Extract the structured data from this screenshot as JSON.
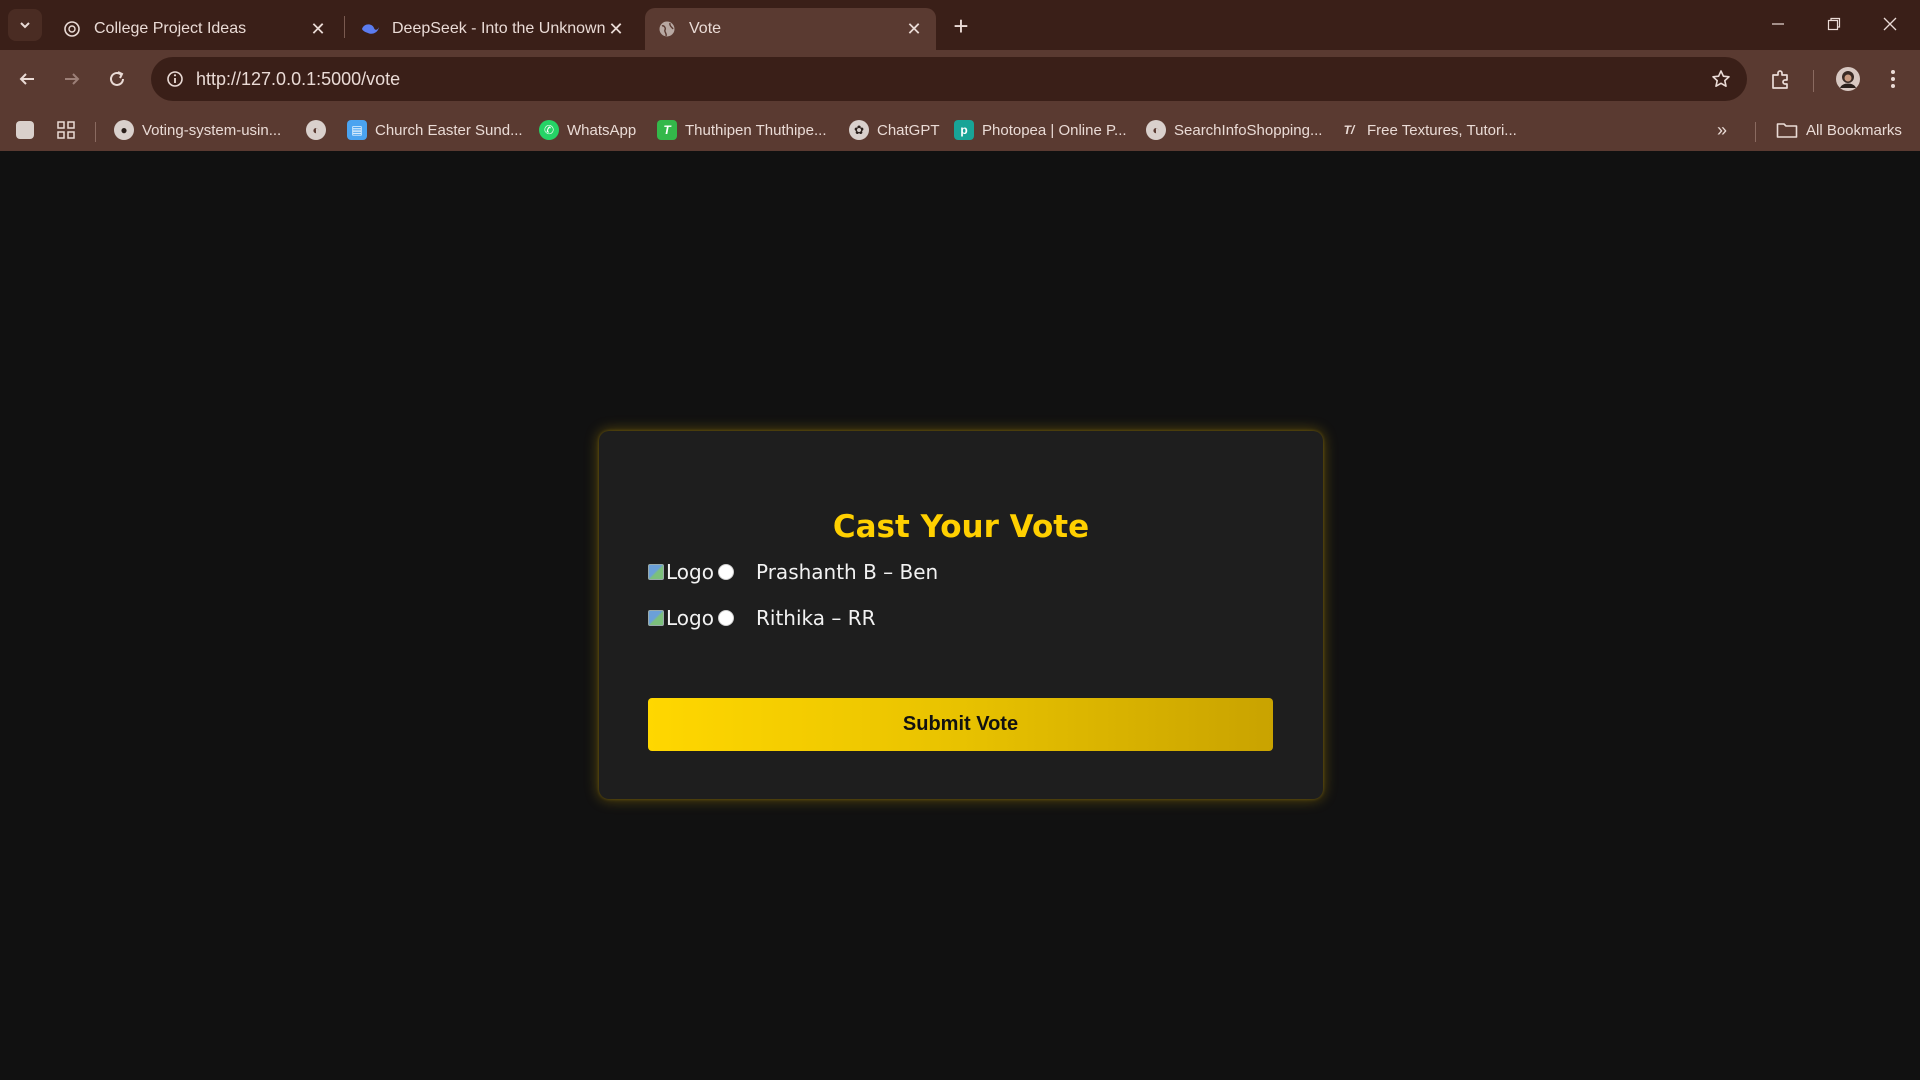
{
  "browser": {
    "tabs": [
      {
        "title": "College Project Ideas",
        "icon": "chatgpt-icon",
        "active": false
      },
      {
        "title": "DeepSeek - Into the Unknown",
        "icon": "deepseek-icon",
        "active": false
      },
      {
        "title": "Vote",
        "icon": "globe-icon",
        "active": true
      }
    ],
    "url": "http://127.0.0.1:5000/vote",
    "bookmarks": [
      {
        "label": "Voting-system-usin...",
        "icon": "github-icon"
      },
      {
        "label": "",
        "icon": "globe-icon"
      },
      {
        "label": "Church Easter Sund...",
        "icon": "docs-icon"
      },
      {
        "label": "WhatsApp",
        "icon": "whatsapp-icon"
      },
      {
        "label": "Thuthipen Thuthipe...",
        "icon": "t-icon"
      },
      {
        "label": "ChatGPT",
        "icon": "chatgpt-icon"
      },
      {
        "label": "Photopea | Online P...",
        "icon": "photopea-icon"
      },
      {
        "label": "SearchInfoShopping...",
        "icon": "globe-icon"
      },
      {
        "label": "Free Textures, Tutori...",
        "icon": "textures-icon"
      }
    ],
    "all_bookmarks_label": "All Bookmarks"
  },
  "vote": {
    "title": "Cast Your Vote",
    "options": [
      {
        "logo_alt": "Logo",
        "label": "Prashanth B – Ben",
        "selected": false
      },
      {
        "logo_alt": "Logo",
        "label": "Rithika – RR",
        "selected": false
      }
    ],
    "submit_label": "Submit Vote"
  },
  "colors": {
    "accent": "#ffd000",
    "card_bg": "#1e1e1e",
    "page_bg": "#111111",
    "chrome": "#5a3a31"
  }
}
